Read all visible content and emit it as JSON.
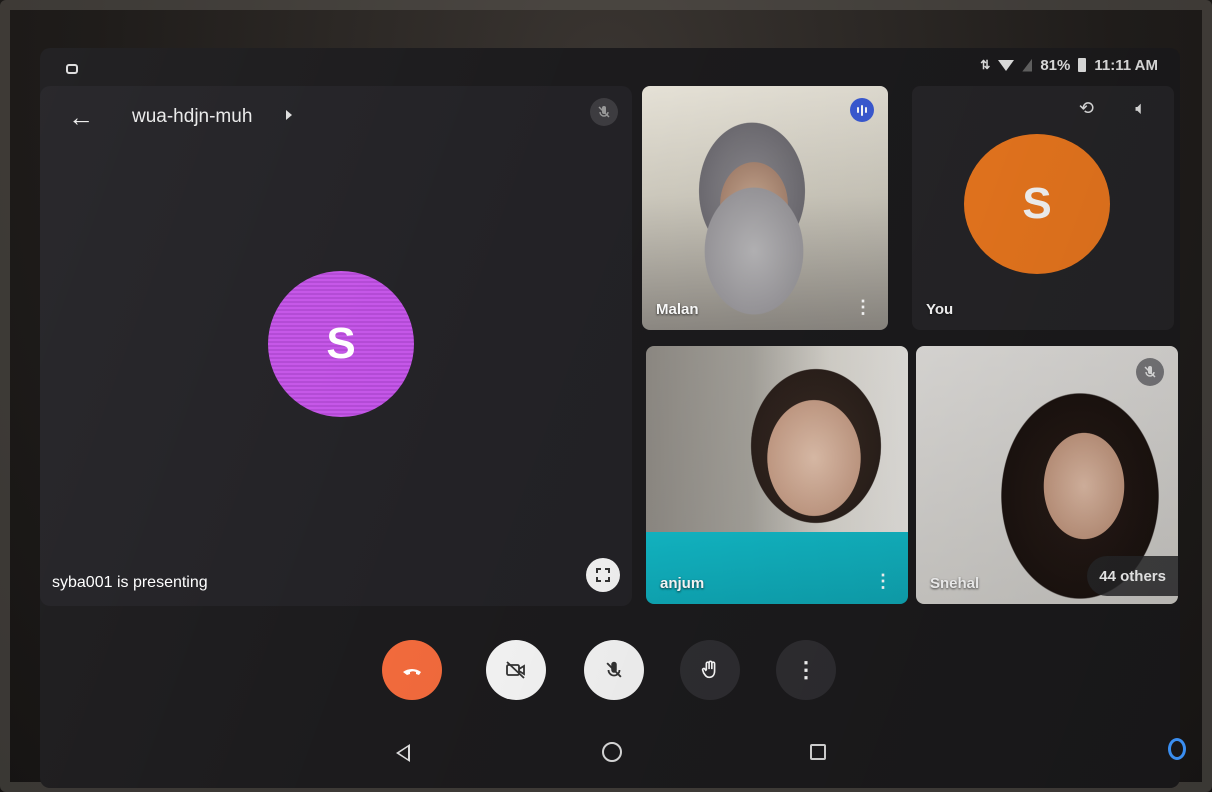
{
  "status_bar": {
    "battery": "81%",
    "time": "11:11 AM"
  },
  "header": {
    "meeting_code": "wua-hdjn-muh"
  },
  "presenter": {
    "avatar_letter": "S",
    "label": "syba001 is presenting",
    "avatar_color": "#c556e8"
  },
  "tiles": [
    {
      "name": "Malan",
      "speaking": true
    },
    {
      "name": "You",
      "avatar_letter": "S",
      "avatar_color": "#f07a1f"
    },
    {
      "name": "anjum"
    },
    {
      "name": "Snehal",
      "muted": true
    }
  ],
  "others": {
    "label": "44 others"
  },
  "controls": {
    "end_call_color": "#f16a3c",
    "buttons": [
      "end-call",
      "camera-off",
      "mic-off",
      "raise-hand",
      "more-options"
    ]
  },
  "nav": {
    "items": [
      "back",
      "home",
      "recents"
    ]
  }
}
